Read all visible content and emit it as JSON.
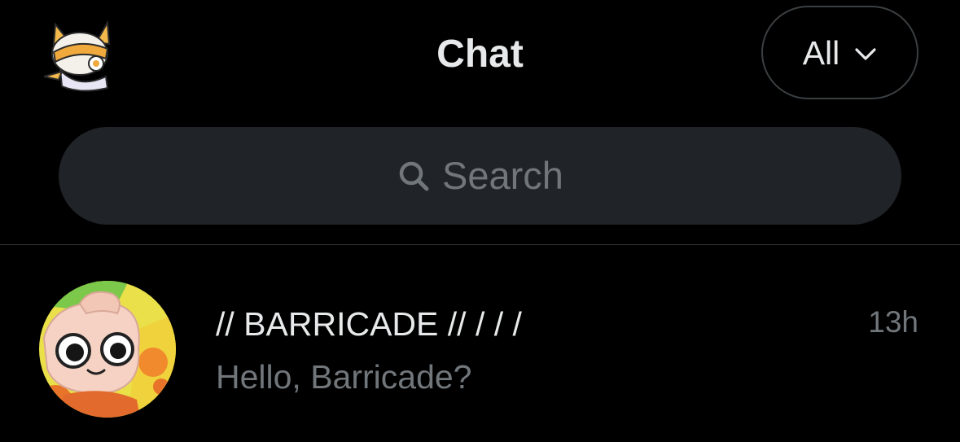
{
  "header": {
    "title": "Chat",
    "filter_label": "All",
    "profile_avatar_icon": "mascot-avatar-icon",
    "filter_icon": "chevron-down-icon"
  },
  "search": {
    "placeholder": "Search",
    "icon": "search-icon"
  },
  "conversations": [
    {
      "name": "// BARRICADE // / / /",
      "preview": "Hello, Barricade?",
      "time": "13h",
      "avatar_icon": "plush-toy-avatar-icon"
    }
  ],
  "colors": {
    "background": "#000000",
    "primary_text": "#e7e9ea",
    "secondary_text": "#71767b",
    "search_background": "#202327",
    "border": "#2f3336"
  }
}
